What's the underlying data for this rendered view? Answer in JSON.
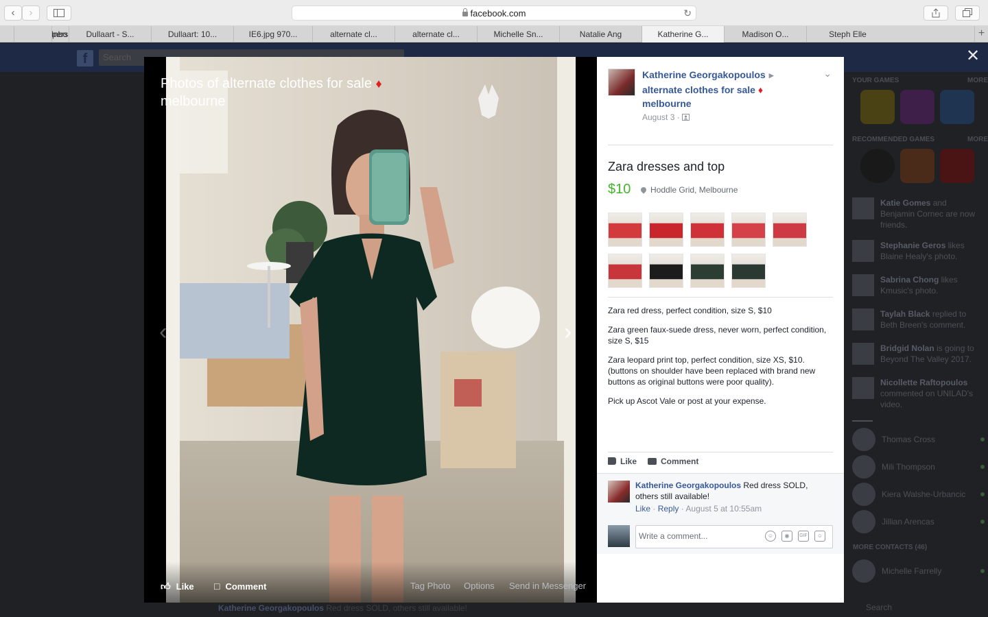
{
  "browser": {
    "url": "facebook.com",
    "tabs": [
      {
        "label": "Inbo"
      },
      {
        "label": "personal sh..."
      },
      {
        "label": "Dullaart - S..."
      },
      {
        "label": "Dullaart: 10..."
      },
      {
        "label": "IE6.jpg 970..."
      },
      {
        "label": "alternate cl..."
      },
      {
        "label": "alternate cl..."
      },
      {
        "label": "Michelle Sn..."
      },
      {
        "label": "Natalie Ang"
      },
      {
        "label": "Katherine G..."
      },
      {
        "label": "Madison O..."
      },
      {
        "label": "Steph Elle"
      }
    ],
    "active_tab_index": 9
  },
  "background": {
    "search_placeholder": "Search",
    "headings": {
      "your_games": "YOUR GAMES",
      "recommended": "RECOMMENDED GAMES",
      "more": "MORE",
      "more_contacts": "MORE CONTACTS (46)",
      "chat_search": "Search"
    },
    "feed": [
      {
        "text_pre": "Katie Gomes",
        "text_post": " and Benjamin Cornec are now friends."
      },
      {
        "text_pre": "Stephanie Geros",
        "text_post": " likes Blaine Healy's photo."
      },
      {
        "text_pre": "Sabrina Chong",
        "text_post": " likes Kmusic's photo."
      },
      {
        "text_pre": "Taylah Black",
        "text_post": " replied to Beth Breen's comment."
      },
      {
        "text_pre": "Bridgid Nolan",
        "text_post": " is going to Beyond The Valley 2017."
      },
      {
        "text_pre": "Nicollette Raftopoulos",
        "text_post": " commented on UNILAD's video."
      }
    ],
    "contacts": [
      {
        "name": "Thomas Cross"
      },
      {
        "name": "Mili Thompson"
      },
      {
        "name": "Kiera Walshe-Urbancic"
      },
      {
        "name": "Jillian Arencas"
      },
      {
        "name": "Michelle Farrelly"
      }
    ],
    "bottom_post_name": "Katherine Georgakopoulos",
    "bottom_post_text": " Red dress SOLD, others still available!"
  },
  "photo": {
    "title": "Photos of alternate clothes for sale",
    "title_line2": "melbourne",
    "diamond": "♦",
    "actions": {
      "like": "Like",
      "comment": "Comment",
      "tag": "Tag Photo",
      "options": "Options",
      "send": "Send in Messenger"
    }
  },
  "post": {
    "author": "Katherine Georgakopoulos",
    "group": "alternate clothes for sale",
    "group_line2": "melbourne",
    "date": "August 3 ·",
    "title": "Zara dresses and top",
    "price": "$10",
    "location": "Hoddle Grid, Melbourne",
    "thumbnails": [
      {
        "color": "#d23a3e"
      },
      {
        "color": "#c8262c"
      },
      {
        "color": "#cf3138"
      },
      {
        "color": "#d44148"
      },
      {
        "color": "#cd3a44"
      },
      {
        "color": "#c8353a"
      },
      {
        "color": "#1c1c1c"
      },
      {
        "color": "#2c3d34"
      },
      {
        "color": "#2a3a33"
      }
    ],
    "description": [
      "Zara red dress, perfect condition, size S, $10",
      "Zara green faux-suede dress, never worn, perfect condition, size S, $15",
      "Zara leopard print top, perfect condition, size XS, $10. (buttons on shoulder have been replaced with brand new buttons as original buttons were poor quality).",
      "Pick up Ascot Vale or post at your expense."
    ],
    "like_label": "Like",
    "comment_label": "Comment"
  },
  "comment": {
    "author": "Katherine Georgakopoulos",
    "text": " Red dress SOLD, others still available!",
    "like": "Like",
    "reply": "Reply",
    "sep": " · ",
    "time": "August 5 at 10:55am",
    "placeholder": "Write a comment..."
  }
}
